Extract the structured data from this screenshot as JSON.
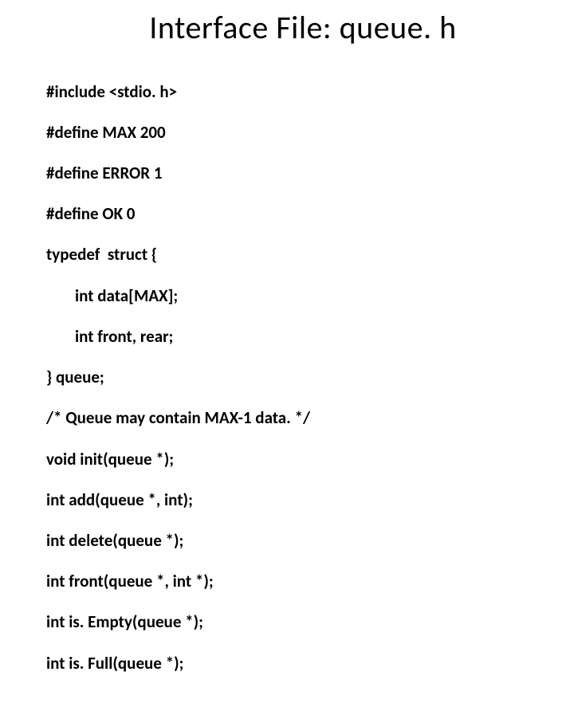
{
  "title": "Interface File: queue. h",
  "code": {
    "l1": "#include <stdio. h>",
    "l2": "#define MAX 200",
    "l3": "#define ERROR 1",
    "l4": "#define OK 0",
    "l5": "typedef  struct {",
    "l6": "int data[MAX];",
    "l7": "int front, rear;",
    "l8": "} queue;",
    "l9": "/* Queue may contain MAX-1 data. */",
    "l10": "void init(queue *);",
    "l11": "int add(queue *, int);",
    "l12": "int delete(queue *);",
    "l13": "int front(queue *, int *);",
    "l14": "int is. Empty(queue *);",
    "l15": "int is. Full(queue *);"
  }
}
